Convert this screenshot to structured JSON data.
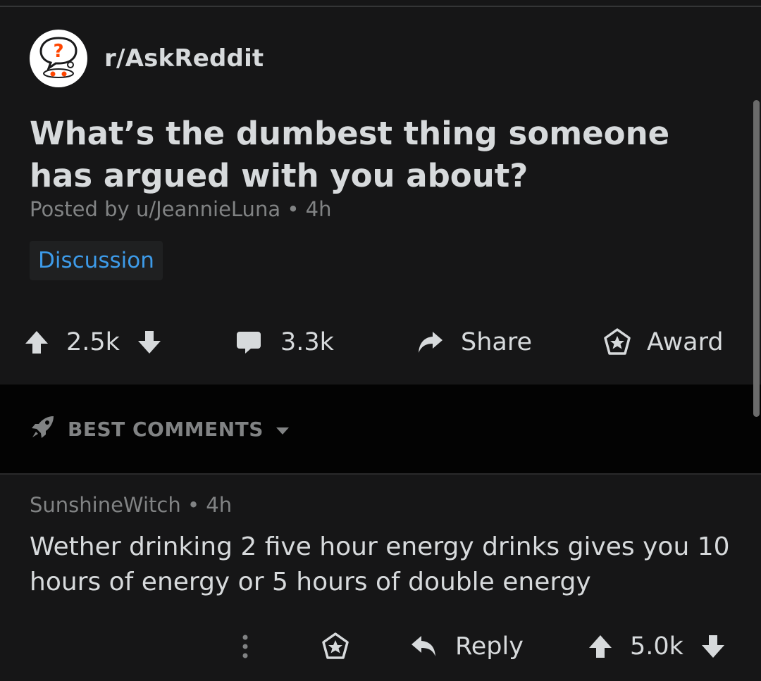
{
  "post": {
    "subreddit": "r/AskReddit",
    "title": "What’s the dumbest thing someone has argued with you about?",
    "posted_by_prefix": "Posted by ",
    "author": "u/JeannieLuna",
    "separator": "•",
    "age": "4h",
    "flair": "Discussion",
    "votes": "2.5k",
    "comments": "3.3k",
    "share_label": "Share",
    "award_label": "Award"
  },
  "sort": {
    "label": "BEST COMMENTS"
  },
  "comment": {
    "author": "SunshineWitch",
    "separator": "•",
    "age": "4h",
    "body": "Wether drinking 2 five hour energy drinks gives you 10 hours of energy or 5 hours of double energy",
    "reply_label": "Reply",
    "votes": "5.0k"
  },
  "colors": {
    "background": "#161617",
    "comments_bar": "#030303",
    "text": "#d7dadc",
    "muted": "#818384",
    "flair_text": "#3d9be9",
    "avatar_question": "#ff4500"
  },
  "icons": [
    "askreddit-avatar-icon",
    "upvote-icon",
    "downvote-icon",
    "comment-icon",
    "share-icon",
    "award-icon",
    "rocket-icon",
    "chevron-down-icon",
    "more-icon",
    "reply-icon"
  ]
}
